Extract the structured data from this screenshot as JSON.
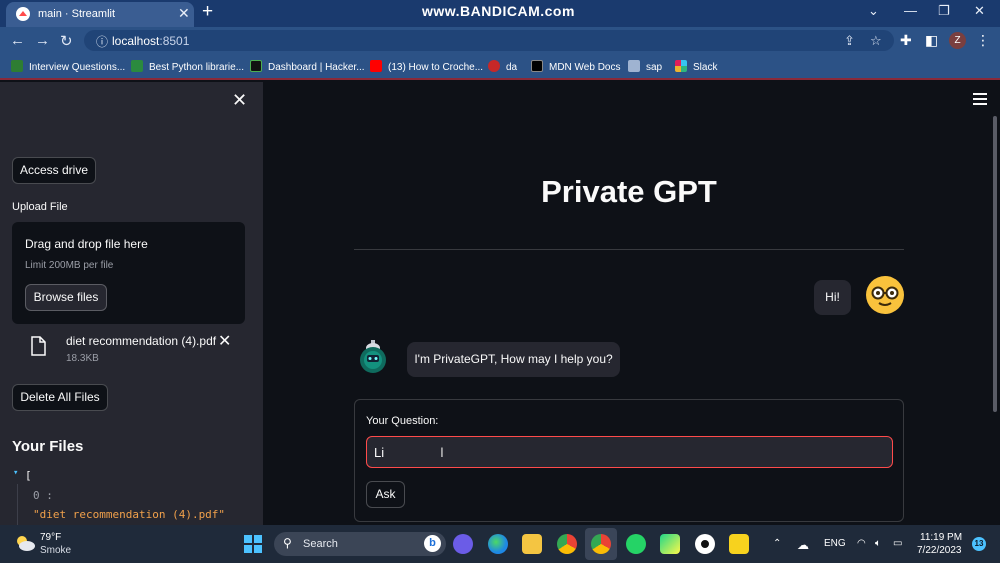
{
  "browser": {
    "tab_title": "main · Streamlit",
    "tab_close": "✕",
    "new_tab": "+",
    "watermark": "www.BANDICAM.com",
    "url_host": "localhost",
    "url_port": ":8501",
    "profile_initial": "Z"
  },
  "bookmarks": [
    {
      "label": "Interview Questions...",
      "color": "#2e7d32"
    },
    {
      "label": "Best Python librarie...",
      "color": "#2b8a3e"
    },
    {
      "label": "Dashboard | Hacker...",
      "color": "#111111"
    },
    {
      "label": "(13) How to Croche...",
      "color": "#ff0000"
    },
    {
      "label": "da",
      "color": "#c62828"
    },
    {
      "label": "MDN Web Docs",
      "color": "#000000"
    },
    {
      "label": "sap",
      "color": "#9fb3d1"
    },
    {
      "label": "Slack",
      "color": "#e01e5a"
    }
  ],
  "sidebar": {
    "close_icon": "✕",
    "access_drive_label": "Access drive",
    "upload_label": "Upload File",
    "dropzone_title": "Drag and drop file here",
    "dropzone_limit": "Limit 200MB per file",
    "browse_label": "Browse files",
    "file_name": "diet recommendation (4).pdf",
    "file_size": "18.3KB",
    "file_remove": "✕",
    "delete_all_label": "Delete All Files",
    "your_files_heading": "Your Files",
    "json_open": "[",
    "json_index": "0 :",
    "json_value": "\"diet recommendation (4).pdf\""
  },
  "main": {
    "title": "Private GPT",
    "user_message": "Hi!",
    "bot_message": "I'm PrivateGPT, How may I help you?",
    "question_label": "Your Question:",
    "question_value": "Li",
    "caret": "I",
    "ask_label": "Ask"
  },
  "taskbar": {
    "temperature": "79°F",
    "condition": "Smoke",
    "search_label": "Search",
    "language": "ENG",
    "time": "11:19 PM",
    "date": "7/22/2023",
    "notifications": "13"
  },
  "colors": {
    "accent": "#ff4b4b",
    "app_bg": "#0e1117",
    "sidebar_bg": "#262730",
    "chrome_tabstrip": "#1a3a6e",
    "chrome_toolbar": "#2c5286"
  }
}
